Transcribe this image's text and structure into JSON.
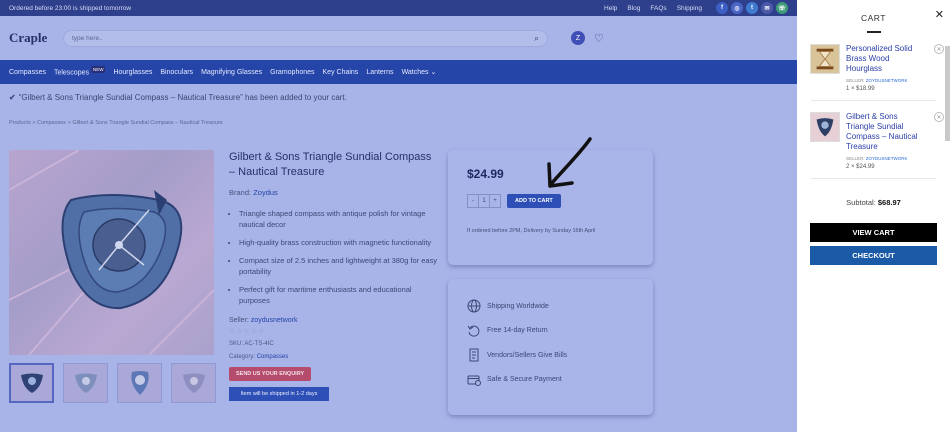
{
  "topbar": {
    "shipping_notice": "Ordered before 23:00 is shipped tomorrow",
    "links": [
      "Help",
      "Blog",
      "FAQs",
      "Shipping"
    ],
    "social_icons": [
      "facebook-icon",
      "instagram-icon",
      "twitter-icon",
      "mail-icon",
      "whatsapp-icon"
    ]
  },
  "header": {
    "logo": "Craple",
    "search_placeholder": "type here..",
    "avatar_letter": "Z"
  },
  "nav": {
    "items": [
      "Compasses",
      "Telescopes",
      "Hourglasses",
      "Binoculars",
      "Magnifying Glasses",
      "Gramophones",
      "Key Chains",
      "Lanterns",
      "Watches"
    ],
    "new_badge": "NEW"
  },
  "notice": "“Gilbert & Sons Triangle Sundial Compass – Nautical Treasure” has been added to your cart.",
  "breadcrumb": [
    "Products",
    "Compasses",
    "Gilbert & Sons Triangle Sundial Compass – Nautical Treasure"
  ],
  "product": {
    "title": "Gilbert & Sons Triangle Sundial Compass – Nautical Treasure",
    "brand_label": "Brand:",
    "brand": "Zoydus",
    "features": [
      "Triangle shaped compass with antique polish for vintage nautical decor",
      "High-quality brass construction with magnetic functionality",
      "Compact size of 2.5 inches and lightweight at 380g for easy portability",
      "Perfect gift for maritime enthusiasts and educational purposes"
    ],
    "seller_label": "Seller:",
    "seller": "zoydusnetwork",
    "stars": "☆☆☆☆☆",
    "sku": "SKU: AC-TS-4IC",
    "category_label": "Category:",
    "category": "Compasses",
    "enquiry_button": "SEND US YOUR ENQUIRY",
    "ship_note": "Item will be shipped in 1-2 days"
  },
  "buybox": {
    "price": "$24.99",
    "qty_minus": "-",
    "qty_value": "1",
    "qty_plus": "+",
    "add_to_cart": "ADD TO CART",
    "delivery": "If ordered before 2PM, Delivery by Sunday 16th April"
  },
  "info": [
    {
      "icon": "globe-icon",
      "label": "Shipping Worldwide"
    },
    {
      "icon": "return-icon",
      "label": "Free 14-day Return"
    },
    {
      "icon": "bill-icon",
      "label": "Vendors/Sellers Give Bills"
    },
    {
      "icon": "secure-payment-icon",
      "label": "Safe & Secure Payment"
    }
  ],
  "cart": {
    "title": "CART",
    "close": "✕",
    "seller_label": "SELLER:",
    "items": [
      {
        "name": "Personalized Solid Brass Wood Hourglass",
        "seller": "ZOYDUSNETWORK",
        "qty_price": "1 × $18.99"
      },
      {
        "name": "Gilbert & Sons Triangle Sundial Compass – Nautical Treasure",
        "seller": "ZOYDUSNETWORK",
        "qty_price": "2 × $24.99"
      }
    ],
    "subtotal_label": "Subtotal:",
    "subtotal": "$68.97",
    "view_cart": "VIEW CART",
    "checkout": "CHECKOUT"
  }
}
